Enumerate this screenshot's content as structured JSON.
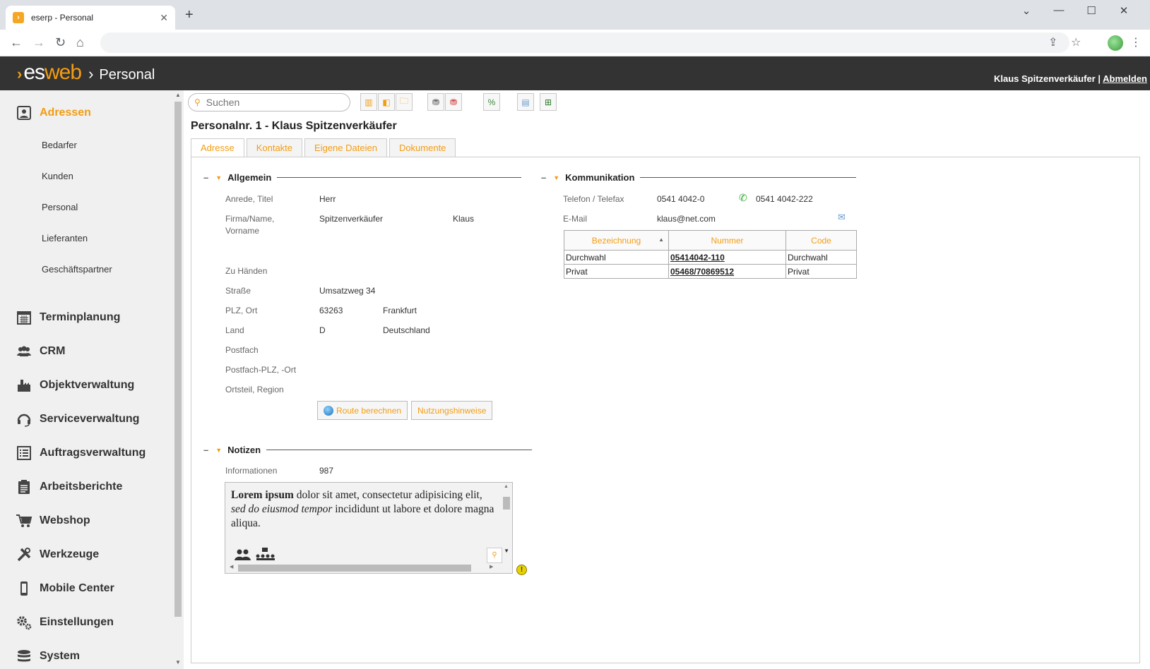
{
  "browser": {
    "tab_title": "eserp - Personal",
    "tab_close": "✕",
    "new_tab": "+",
    "window_controls": [
      "⌄",
      "—",
      "☐",
      "✕"
    ]
  },
  "app": {
    "brand_es": "es",
    "brand_web": "web",
    "module": "Personal",
    "user_name": "Klaus Spitzenverkäufer",
    "separator": "|",
    "logout": "Abmelden"
  },
  "sidebar": {
    "main": [
      {
        "label": "Adressen",
        "icon": "contact-card-icon",
        "active": true
      },
      {
        "label": "Terminplanung",
        "icon": "calendar-icon"
      },
      {
        "label": "CRM",
        "icon": "people-icon"
      },
      {
        "label": "Objektverwaltung",
        "icon": "building-icon"
      },
      {
        "label": "Serviceverwaltung",
        "icon": "headset-icon"
      },
      {
        "label": "Auftragsverwaltung",
        "icon": "list-icon"
      },
      {
        "label": "Arbeitsberichte",
        "icon": "clipboard-icon"
      },
      {
        "label": "Webshop",
        "icon": "cart-icon"
      },
      {
        "label": "Werkzeuge",
        "icon": "tools-icon"
      },
      {
        "label": "Mobile Center",
        "icon": "mobile-icon"
      },
      {
        "label": "Einstellungen",
        "icon": "gears-icon"
      },
      {
        "label": "System",
        "icon": "database-icon"
      }
    ],
    "sub": [
      "Bedarfer",
      "Kunden",
      "Personal",
      "Lieferanten",
      "Geschäftspartner"
    ]
  },
  "search": {
    "placeholder": "Suchen"
  },
  "page": {
    "title": "Personalnr. 1 - Klaus Spitzenverkäufer",
    "tabs": [
      "Adresse",
      "Kontakte",
      "Eigene Dateien",
      "Dokumente"
    ]
  },
  "allgemein": {
    "heading": "Allgemein",
    "anrede_label": "Anrede, Titel",
    "anrede": "Herr",
    "firma_label_1": "Firma/Name,",
    "firma_label_2": "Vorname",
    "name": "Spitzenverkäufer",
    "vorname": "Klaus",
    "zu_haenden_label": "Zu Händen",
    "strasse_label": "Straße",
    "strasse": "Umsatzweg 34",
    "plz_label": "PLZ, Ort",
    "plz": "63263",
    "ort": "Frankfurt",
    "land_label": "Land",
    "land_code": "D",
    "land": "Deutschland",
    "postfach_label": "Postfach",
    "postfach_plz_label": "Postfach-PLZ, -Ort",
    "ortsteil_label": "Ortsteil, Region",
    "route_button": "Route berechnen",
    "hinweise_button": "Nutzungshinweise"
  },
  "kommunikation": {
    "heading": "Kommunikation",
    "telefon_label": "Telefon / Telefax",
    "telefon": "0541 4042-0",
    "telefax": "0541 4042-222",
    "email_label": "E-Mail",
    "email": "klaus@net.com",
    "table": {
      "headers": [
        "Bezeichnung",
        "Nummer",
        "Code"
      ],
      "rows": [
        [
          "Durchwahl",
          "05414042-110",
          "Durchwahl"
        ],
        [
          "Privat",
          "05468/70869512",
          "Privat"
        ]
      ]
    }
  },
  "notizen": {
    "heading": "Notizen",
    "info_label": "Informationen",
    "info_value": "987",
    "text_bold": "Lorem ipsum",
    "text_1": " dolor sit amet, consectetur adipisicing elit, ",
    "text_italic": "sed do eiusmod tempor",
    "text_2": " incididunt ut labore et dolore magna aliqua."
  }
}
